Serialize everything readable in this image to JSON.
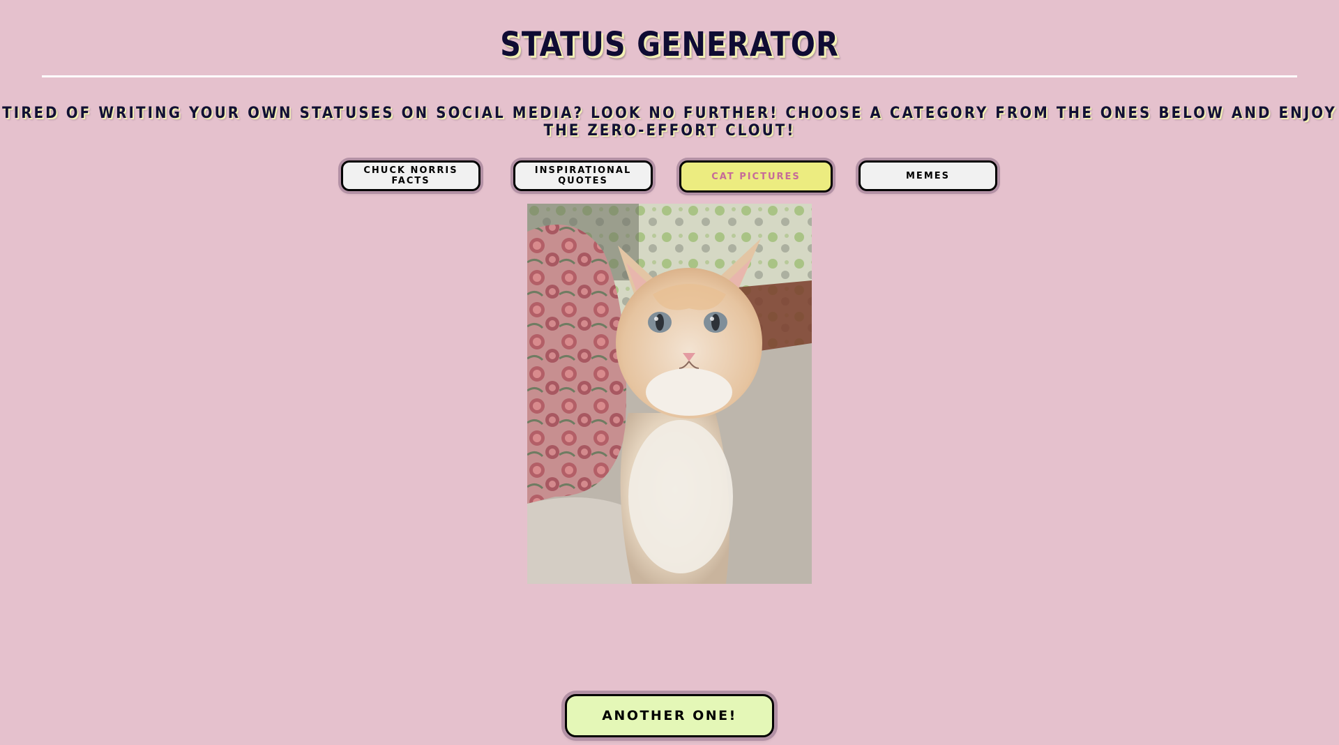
{
  "header": {
    "title": "STATUS GENERATOR",
    "tagline": "TIRED OF WRITING YOUR OWN STATUSES ON SOCIAL MEDIA? LOOK NO FURTHER! CHOOSE A CATEGORY FROM THE ONES BELOW AND ENJOY THE ZERO-EFFORT CLOUT!"
  },
  "categories": [
    {
      "label": "CHUCK NORRIS FACTS",
      "active": false
    },
    {
      "label": "INSPIRATIONAL QUOTES",
      "active": false
    },
    {
      "label": "CAT PICTURES",
      "active": true
    },
    {
      "label": "MEMES",
      "active": false
    }
  ],
  "result": {
    "image_subject": "cat-photo"
  },
  "actions": {
    "another_label": "ANOTHER ONE!"
  },
  "colors": {
    "background": "#e5c1cd",
    "button": "#f1f1f1",
    "button_active": "#ecec80",
    "button_active_text": "#c66a99",
    "another_button": "#e4f7b7",
    "title_text": "#0f0c33"
  }
}
